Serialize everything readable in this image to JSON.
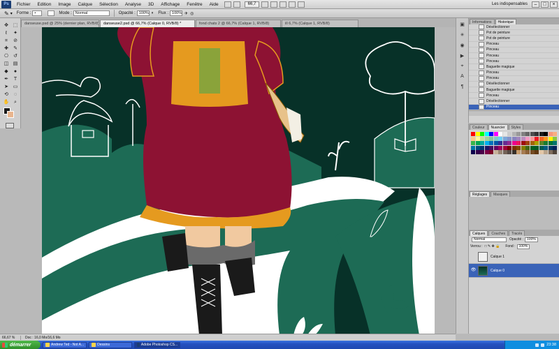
{
  "app": {
    "logo": "Ps",
    "menus": [
      "Fichier",
      "Edition",
      "Image",
      "Calque",
      "Sélection",
      "Analyse",
      "3D",
      "Affichage",
      "Fenêtre",
      "Aide"
    ],
    "zoom_box": "66,7",
    "workspace": "Les indispensables"
  },
  "options_bar": {
    "forme_label": "Forme :",
    "mode_label": "Mode :",
    "mode_value": "Normal",
    "opacity_label": "Opacité :",
    "opacity_value": "100%",
    "flux_label": "Flux :",
    "flux_value": "100%"
  },
  "tabs": [
    {
      "label": "danseuse.psd @ 25% (dernier plan, RVB/8)"
    },
    {
      "label": "danseuse2.psd @ 66,7% (Calque 0, RVB/8) *"
    },
    {
      "label": "fond chats 2 @ 66,7% (Calque 1, RVB/8)"
    },
    {
      "label": "ill 6,7% (Calque 1, RVB/8)"
    }
  ],
  "history": {
    "tabs": [
      "Informations",
      "Historique"
    ],
    "items": [
      "Désélectionner",
      "Pot de peinture",
      "Pot de peinture",
      "Pinceau",
      "Pinceau",
      "Pinceau",
      "Pinceau",
      "Baguette magique",
      "Pinceau",
      "Pinceau",
      "Désélectionner",
      "Baguette magique",
      "Pinceau",
      "Désélectionner",
      "Pinceau"
    ],
    "selected_index": 14
  },
  "swatches": {
    "tabs": [
      "Couleur",
      "Nuancier",
      "Styles"
    ],
    "colors": [
      "#ff0000",
      "#ffff00",
      "#00ff00",
      "#00ffff",
      "#0000ff",
      "#ff00ff",
      "#ffffff",
      "#e6e6e6",
      "#cccccc",
      "#b3b3b3",
      "#999999",
      "#808080",
      "#666666",
      "#4d4d4d",
      "#333333",
      "#1a1a1a",
      "#000000",
      "#f7977a",
      "#f9ad81",
      "#fdc68a",
      "#fff79a",
      "#c4df9b",
      "#a2d39c",
      "#82ca9d",
      "#7bcdc8",
      "#6ecff6",
      "#7ea7d8",
      "#8493ca",
      "#8882be",
      "#a187be",
      "#bc8dbf",
      "#f49ac2",
      "#f6989d",
      "#ed1c24",
      "#f26522",
      "#f7941d",
      "#fff200",
      "#8dc63f",
      "#39b54a",
      "#00a651",
      "#00a99d",
      "#00aeef",
      "#0072bc",
      "#0054a6",
      "#2e3192",
      "#662d91",
      "#92278f",
      "#ec008c",
      "#ed145b",
      "#9e0b0f",
      "#a0410d",
      "#a36209",
      "#aba000",
      "#598527",
      "#1a7b30",
      "#007236",
      "#00746b",
      "#0076a3",
      "#004b80",
      "#003471",
      "#1b1464",
      "#440e62",
      "#630460",
      "#9e005d",
      "#9e0039",
      "#790000",
      "#7b2e00",
      "#7d4900",
      "#827b00",
      "#406618",
      "#005e20",
      "#005826",
      "#005952",
      "#005b7f",
      "#003663",
      "#002157",
      "#0d004c",
      "#32004b",
      "#4b0049",
      "#7b0046",
      "#7a0026",
      "#c7b299",
      "#998675",
      "#736357",
      "#534741",
      "#37302a",
      "#c69c6d",
      "#a67c52",
      "#8c6239",
      "#754c24",
      "#603913",
      "#e2c6a8",
      "#b9a48c",
      "#7d6b5b",
      "#4f4339"
    ]
  },
  "right_mid": {
    "tabs": [
      "Réglages",
      "Masques"
    ]
  },
  "layers": {
    "tabs": [
      "Calques",
      "Couches",
      "Tracés"
    ],
    "blend": "Normal",
    "opacity_label": "Opacité :",
    "opacity_value": "100%",
    "lock_label": "Verrou :",
    "fill_label": "Fond :",
    "fill_value": "100%",
    "items": [
      {
        "name": "Calque 1",
        "selected": false
      },
      {
        "name": "Calque 0",
        "selected": true
      }
    ]
  },
  "status": {
    "zoom": "66,67 %",
    "doc": "Doc : 16,0 Mo/16,6 Mo"
  },
  "taskbar": {
    "start": "démarrer",
    "tasks": [
      {
        "label": "Andrew Ted - Not A...",
        "active": false
      },
      {
        "label": "Dessins",
        "active": false
      },
      {
        "label": "Adobe Photoshop CS...",
        "active": true
      }
    ],
    "clock": "23:38"
  },
  "colors": {
    "canvas_bg": "#073128",
    "hill": "#1d6b55",
    "path": "#ffffff",
    "dress": "#8d1233",
    "corset": "#e59a1f",
    "fg_color": "#1a1a1a",
    "bg_color": "#e8b58e"
  }
}
